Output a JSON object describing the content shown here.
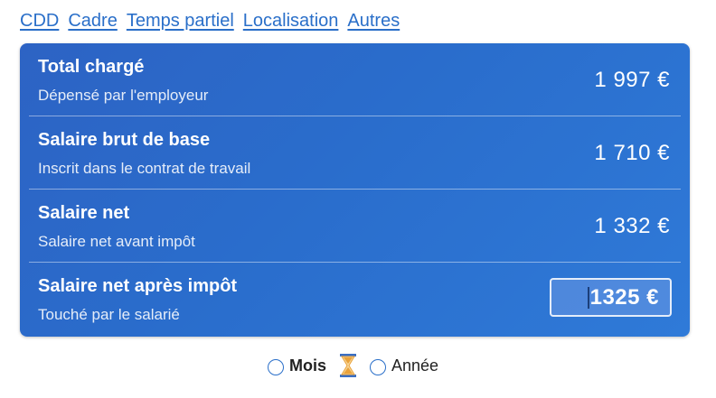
{
  "tabs": [
    {
      "label": "CDD"
    },
    {
      "label": "Cadre"
    },
    {
      "label": "Temps partiel"
    },
    {
      "label": "Localisation"
    },
    {
      "label": "Autres"
    }
  ],
  "rows": [
    {
      "title": "Total chargé",
      "subtitle": "Dépensé par l'employeur",
      "value": "1 997 €"
    },
    {
      "title": "Salaire brut de base",
      "subtitle": "Inscrit dans le contrat de travail",
      "value": "1 710 €"
    },
    {
      "title": "Salaire net",
      "subtitle": "Salaire net avant impôt",
      "value": "1 332 €"
    },
    {
      "title": "Salaire net après impôt",
      "subtitle": "Touché par le salarié",
      "value": "1325 €"
    }
  ],
  "period": {
    "month_label": "Mois",
    "year_label": "Année",
    "hourglass_icon": "hourglass-icon"
  },
  "colors": {
    "link": "#2a6fc9",
    "card": "#2a6dcc",
    "hourglass": "#e9a23b"
  }
}
